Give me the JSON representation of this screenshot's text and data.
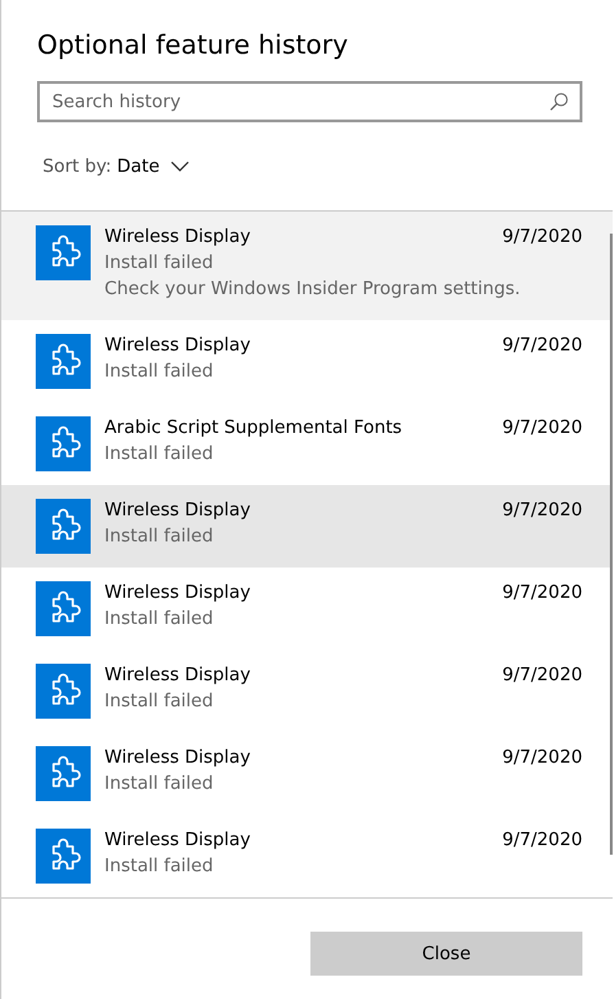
{
  "dialog": {
    "title": "Optional feature history",
    "search": {
      "placeholder": "Search history"
    },
    "sort": {
      "label": "Sort by:",
      "value": "Date"
    },
    "items": [
      {
        "name": "Wireless Display",
        "status": "Install failed",
        "date": "9/7/2020",
        "detail": "Check your Windows Insider Program settings.",
        "expanded": true,
        "hovered": false
      },
      {
        "name": "Wireless Display",
        "status": "Install failed",
        "date": "9/7/2020",
        "expanded": false,
        "hovered": false
      },
      {
        "name": "Arabic Script Supplemental Fonts",
        "status": "Install failed",
        "date": "9/7/2020",
        "expanded": false,
        "hovered": false
      },
      {
        "name": "Wireless Display",
        "status": "Install failed",
        "date": "9/7/2020",
        "expanded": false,
        "hovered": true
      },
      {
        "name": "Wireless Display",
        "status": "Install failed",
        "date": "9/7/2020",
        "expanded": false,
        "hovered": false
      },
      {
        "name": "Wireless Display",
        "status": "Install failed",
        "date": "9/7/2020",
        "expanded": false,
        "hovered": false
      },
      {
        "name": "Wireless Display",
        "status": "Install failed",
        "date": "9/7/2020",
        "expanded": false,
        "hovered": false
      },
      {
        "name": "Wireless Display",
        "status": "Install failed",
        "date": "9/7/2020",
        "expanded": false,
        "hovered": false
      }
    ],
    "buttons": [
      "Close"
    ]
  }
}
